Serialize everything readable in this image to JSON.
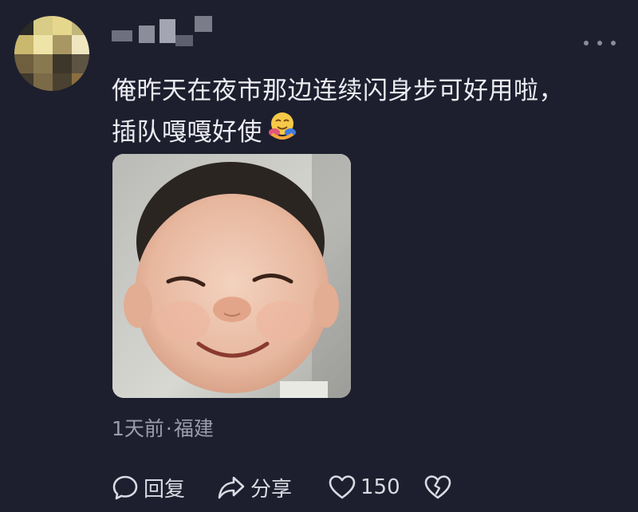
{
  "comment": {
    "text_line1": "俺昨天在夜市那边连续闪身步可好用啦，",
    "text_line2": "插队嘎嘎好使",
    "emoji_icon": "smiling-face-with-hug-emoji",
    "time": "1天前",
    "separator": "·",
    "location": "福建"
  },
  "actions": {
    "reply_label": "回复",
    "share_label": "分享",
    "like_count": "150",
    "dislike_icon": "broken-heart-icon"
  },
  "colors": {
    "background": "#1d1f2e",
    "text_primary": "#ececf2",
    "text_secondary": "#9b9dab"
  }
}
